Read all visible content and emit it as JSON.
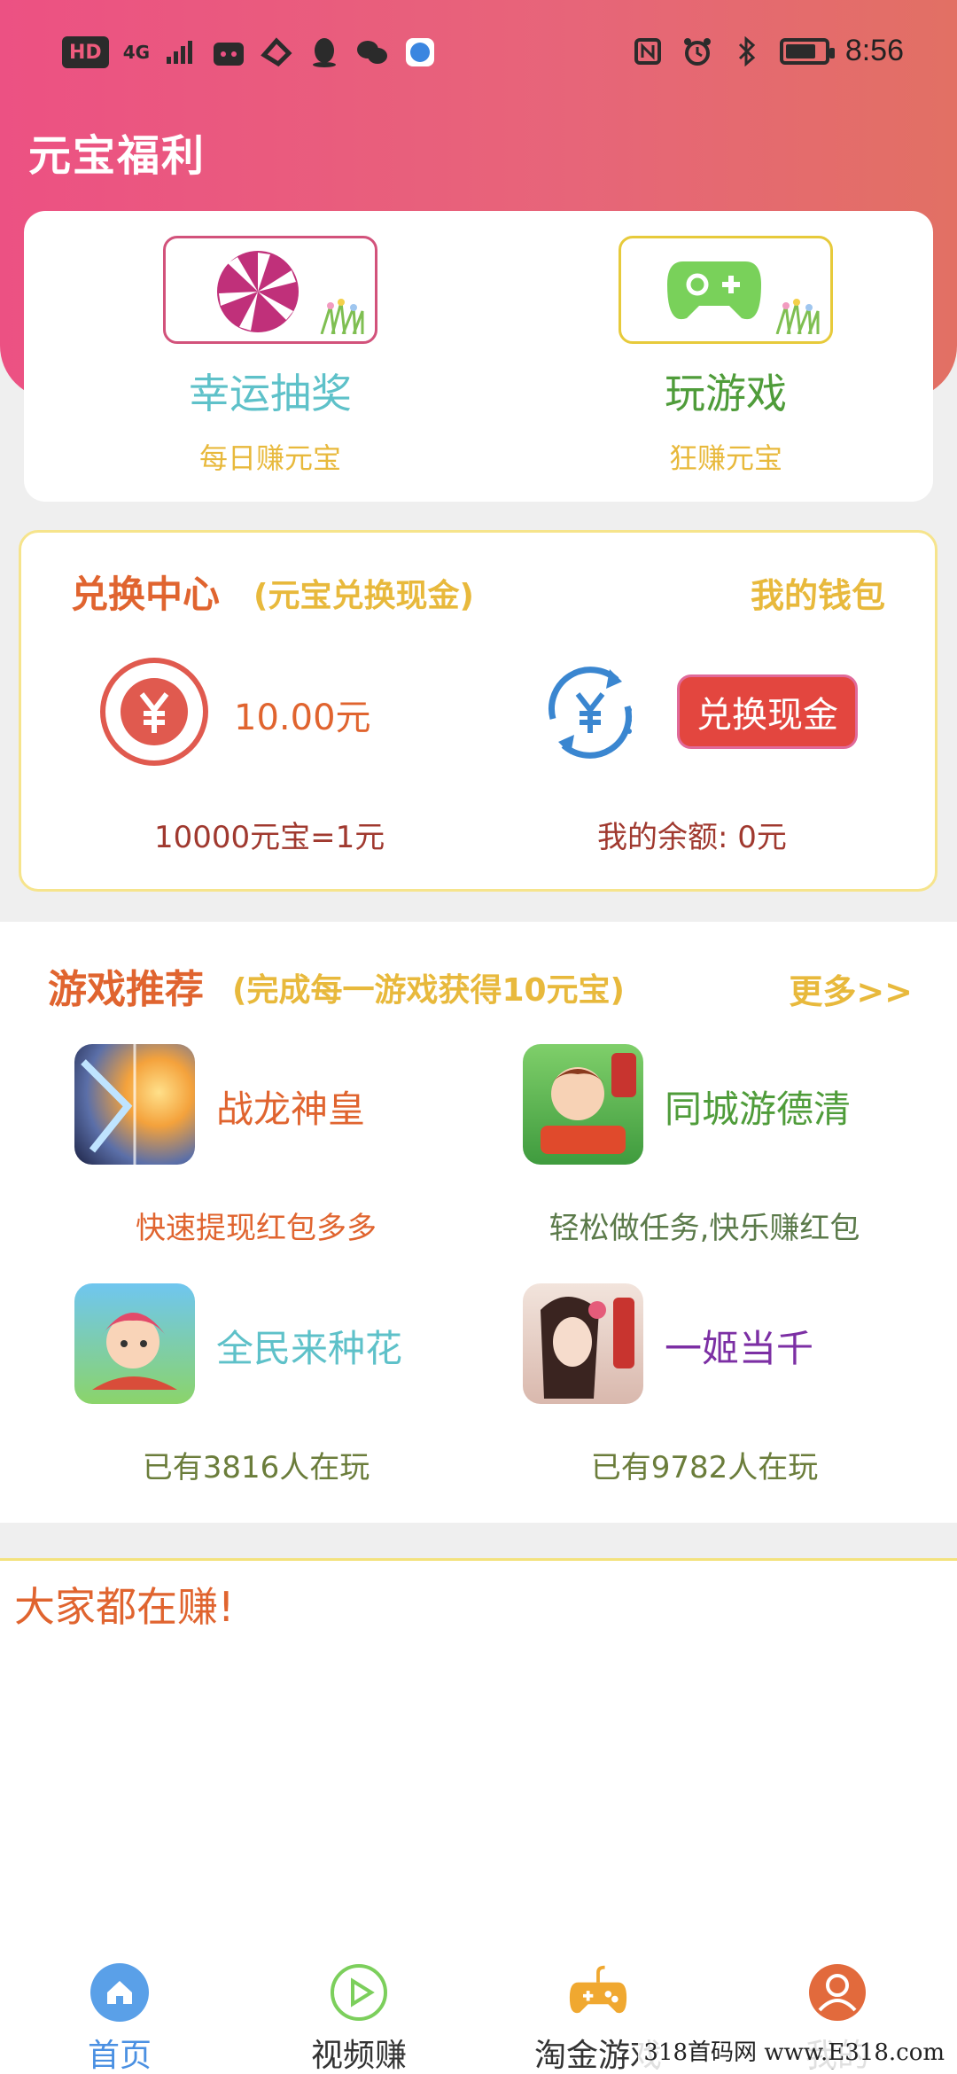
{
  "status_bar": {
    "left_chips": [
      "HD",
      "4G"
    ],
    "time": "8:56",
    "icons": [
      "signal-icon",
      "cat-app-icon",
      "hand-app-icon",
      "qq-icon",
      "wechat-icon",
      "browser-icon",
      "nfc-icon",
      "alarm-icon",
      "bluetooth-icon",
      "battery-icon"
    ]
  },
  "header": {
    "title": "元宝福利"
  },
  "features": [
    {
      "title": "幸运抽奖",
      "sub": "每日赚元宝",
      "icon": "lucky-wheel-icon",
      "title_color": "#5ec1c9",
      "frame_color": "#d2527b"
    },
    {
      "title": "玩游戏",
      "sub": "狂赚元宝",
      "icon": "gamepad-icon",
      "title_color": "#4f9c3a",
      "frame_color": "#e7ca3b"
    }
  ],
  "exchange": {
    "title": "兑换中心",
    "subtitle": "(元宝兑换现金)",
    "wallet_link": "我的钱包",
    "amount": "10.00元",
    "rate": "10000元宝=1元",
    "button": "兑换现金",
    "balance": "我的余额: 0元"
  },
  "games": {
    "title": "游戏推荐",
    "subtitle": "(完成每一游戏获得10元宝)",
    "more": "更多>>",
    "items": [
      {
        "name": "战龙神皇",
        "desc": "快速提现红包多多",
        "name_color": "#e0642f",
        "desc_color": "#e0642f"
      },
      {
        "name": "同城游德清",
        "desc": "轻松做任务,快乐赚红包",
        "name_color": "#4f9c3a",
        "desc_color": "#5b7a4a"
      },
      {
        "name": "全民来种花",
        "desc": "已有3816人在玩",
        "name_color": "#5ec1c9",
        "desc_color": "#6b7d3b"
      },
      {
        "name": "一姬当千",
        "desc": "已有9782人在玩",
        "name_color": "#7c2fa4",
        "desc_color": "#6b7d3b"
      }
    ]
  },
  "earn": {
    "title": "大家都在赚!"
  },
  "tabs": [
    {
      "label": "首页",
      "icon": "home-icon",
      "active": true
    },
    {
      "label": "视频赚",
      "icon": "play-icon",
      "active": false
    },
    {
      "label": "淘金游戏",
      "icon": "gamepad-icon",
      "active": false
    },
    {
      "label": "我的",
      "icon": "profile-icon",
      "active": false
    }
  ],
  "watermark": "318首码网 www.E318.com",
  "colors": {
    "accent_pink": "#ec5183",
    "accent_orange": "#e0642f",
    "accent_gold": "#e8b93c",
    "button_red": "#e3463f",
    "tab_active": "#4a90e2"
  }
}
